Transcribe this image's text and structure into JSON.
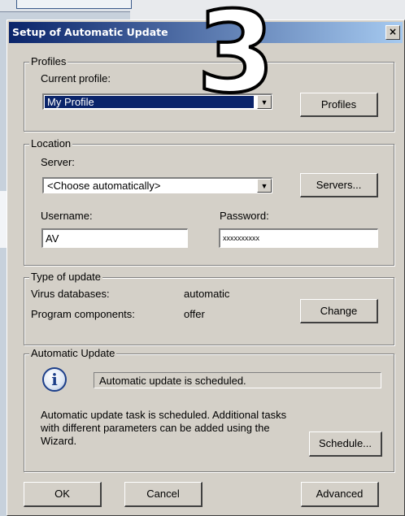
{
  "dialog": {
    "title": "Setup of Automatic Update",
    "close_glyph": "×"
  },
  "overlay": {
    "step_number": "3"
  },
  "profiles": {
    "legend": "Profiles",
    "current_profile_label": "Current profile:",
    "current_profile_value": "My Profile",
    "profiles_button": "Profiles"
  },
  "location": {
    "legend": "Location",
    "server_label": "Server:",
    "server_value": "<Choose automatically>",
    "servers_button": "Servers...",
    "username_label": "Username:",
    "username_value": "AV",
    "password_label": "Password:",
    "password_value": "xxxxxxxxxx"
  },
  "type_of_update": {
    "legend": "Type of update",
    "virus_label": "Virus databases:",
    "virus_value": "automatic",
    "program_label": "Program components:",
    "program_value": "offer",
    "change_button": "Change"
  },
  "automatic_update": {
    "legend": "Automatic Update",
    "status_text": "Automatic update is scheduled.",
    "description": "Automatic update task is scheduled. Additional tasks with different parameters can be added using the Wizard.",
    "schedule_button": "Schedule..."
  },
  "footer": {
    "ok_button": "OK",
    "cancel_button": "Cancel",
    "advanced_button": "Advanced"
  },
  "icons": [
    "close-icon",
    "dropdown-arrow-icon",
    "info-icon"
  ]
}
